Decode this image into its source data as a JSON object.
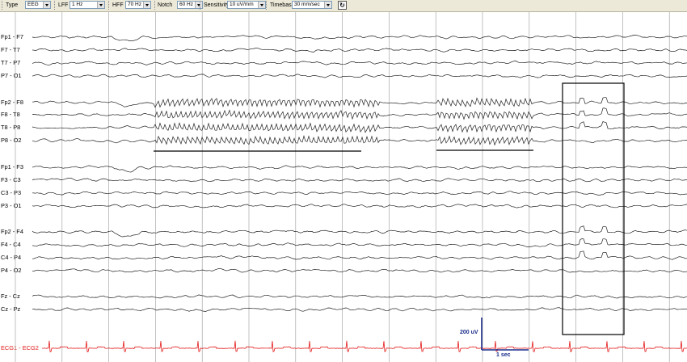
{
  "toolbar": {
    "type_label": "Type",
    "type_value": "EEG",
    "lff_label": "LFF",
    "lff_value": "1 Hz",
    "hff_label": "HFF",
    "hff_value": "70 Hz",
    "notch_label": "Notch",
    "notch_value": "60 Hz",
    "sensitivity_label": "Sensitivity",
    "sensitivity_value": "10 uV/mm",
    "timebase_label": "Timebase",
    "timebase_value": "30 mm/sec",
    "refresh_icon": "refresh-icon"
  },
  "channels": [
    "Fp1 - F7",
    "F7 - T7",
    "T7 - P7",
    "P7 - O1",
    "Fp2 - F8",
    "F8 - T8",
    "T8 - P8",
    "P8 - O2",
    "Fp1 - F3",
    "F3 - C3",
    "C3 - P3",
    "P3 - O1",
    "Fp2 - F4",
    "F4 - C4",
    "C4 - P4",
    "P4 - O2",
    "Fz - Cz",
    "Cz - Pz",
    "ECG1 - ECG2"
  ],
  "calibration": {
    "amplitude": "200 uV",
    "time": "1 sec"
  },
  "colors": {
    "trace": "#222222",
    "ecg": "#e31a1a",
    "grid": "#9a9a9a",
    "calibration": "#1a2c8a",
    "toolbar": "#ece9d8"
  }
}
